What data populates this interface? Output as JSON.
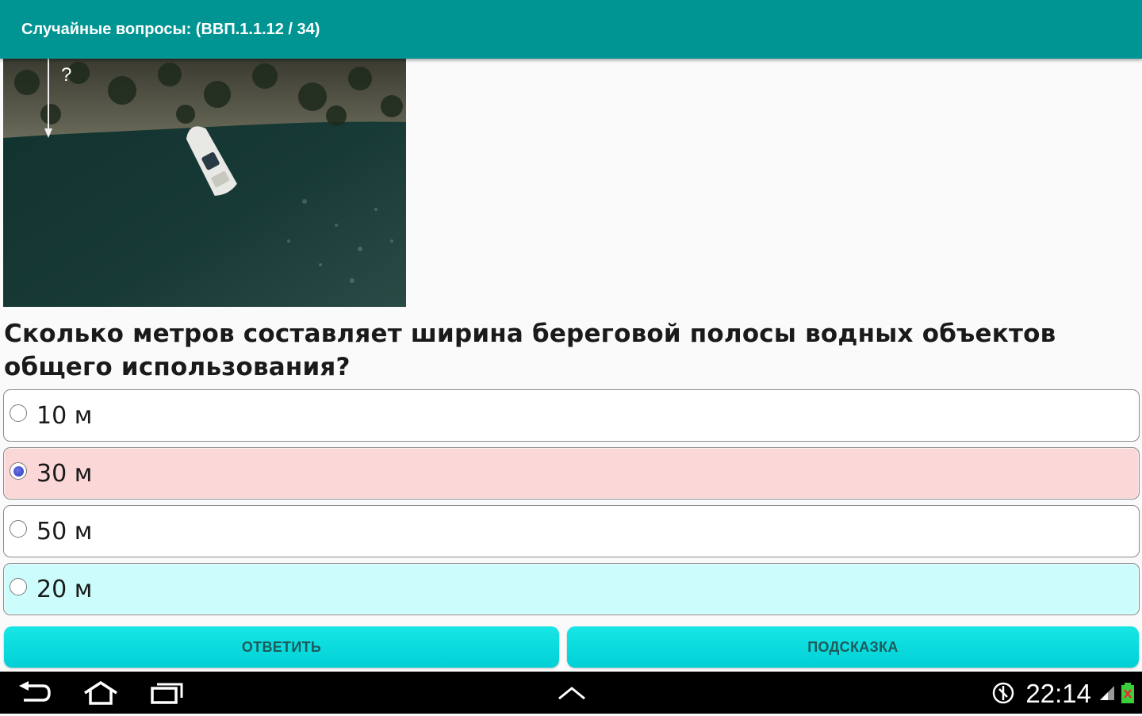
{
  "app_bar": {
    "title": "Случайные вопросы: (ВВП.1.1.12 / 34)"
  },
  "image": {
    "overlay_text": "?"
  },
  "question": {
    "text": "Сколько метров составляет ширина береговой полосы водных объектов общего использования?"
  },
  "options": [
    {
      "label": "10 м",
      "selected": false,
      "state": "neutral"
    },
    {
      "label": "30 м",
      "selected": true,
      "state": "wrong"
    },
    {
      "label": "50 м",
      "selected": false,
      "state": "neutral"
    },
    {
      "label": "20 м",
      "selected": false,
      "state": "correct"
    }
  ],
  "buttons": {
    "answer": "ОТВЕТИТЬ",
    "hint": "ПОДСКАЗКА"
  },
  "system_bar": {
    "time": "22:14",
    "icons": [
      "back-icon",
      "home-icon",
      "recent-apps-icon",
      "chevron-up-icon",
      "data-saver-icon",
      "signal-icon",
      "battery-icon"
    ]
  },
  "colors": {
    "app_bar": "#009492",
    "wrong_option": "#fbd7d7",
    "correct_option": "#ccfcfc",
    "button": "#00d8dc"
  }
}
